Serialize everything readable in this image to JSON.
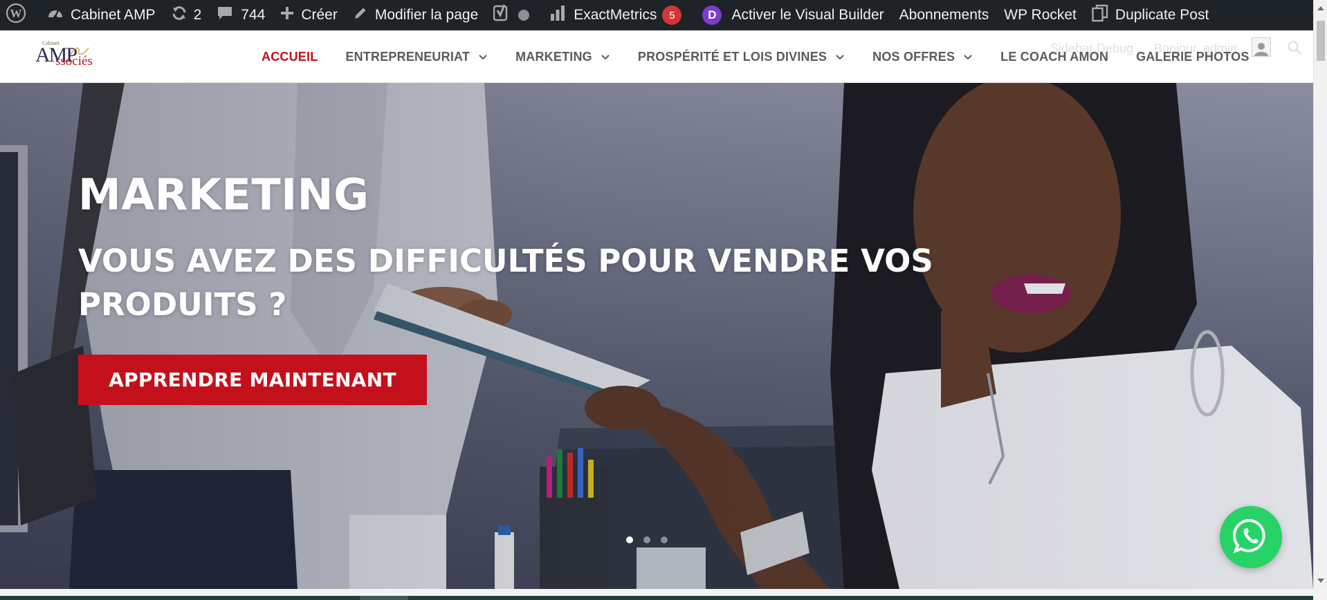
{
  "adminbar": {
    "site_name": "Cabinet AMP",
    "updates_count": "2",
    "comments_count": "744",
    "new_label": "Créer",
    "edit_label": "Modifier la page",
    "exactmetrics_label": "ExactMetrics",
    "exactmetrics_badge": "5",
    "divi_letter": "D",
    "visual_builder_label": "Activer le Visual Builder",
    "subscriptions_label": "Abonnements",
    "wprocket_label": "WP Rocket",
    "duplicate_label": "Duplicate Post"
  },
  "header": {
    "logo": {
      "small": "Cabinet",
      "amp": "AMP",
      "associes": "ssociés"
    },
    "ghost_sidebar_debug": "Sidebar Debug",
    "ghost_greeting": "Bonjour, admin",
    "nav": [
      {
        "label": "ACCUEIL",
        "active": true,
        "has_dropdown": false
      },
      {
        "label": "ENTREPRENEURIAT",
        "active": false,
        "has_dropdown": true
      },
      {
        "label": "MARKETING",
        "active": false,
        "has_dropdown": true
      },
      {
        "label": "PROSPÉRITÉ ET LOIS DIVINES",
        "active": false,
        "has_dropdown": true
      },
      {
        "label": "NOS OFFRES",
        "active": false,
        "has_dropdown": true
      },
      {
        "label": "LE COACH AMON",
        "active": false,
        "has_dropdown": false
      },
      {
        "label": "GALERIE PHOTOS",
        "active": false,
        "has_dropdown": false
      }
    ]
  },
  "hero": {
    "title": "MARKETING",
    "subtitle": "VOUS AVEZ DES DIFFICULTÉS POUR VENDRE VOS PRODUITS ?",
    "cta_label": "APPRENDRE MAINTENANT",
    "slides_count": 3,
    "active_slide": 1
  },
  "colors": {
    "adminbar_bg": "#1d2327",
    "accent_red": "#c4101b",
    "whatsapp_green": "#25d366",
    "badge_red": "#d63638"
  },
  "icons": {
    "wordpress": "wordpress-icon",
    "dashboard": "dashboard-icon",
    "updates": "refresh-icon",
    "comments": "comment-icon",
    "new": "plus-icon",
    "edit": "pencil-icon",
    "yoast": "yoast-icon",
    "stats": "bar-chart-icon",
    "duplicate": "copy-icon",
    "whatsapp": "whatsapp-icon"
  }
}
